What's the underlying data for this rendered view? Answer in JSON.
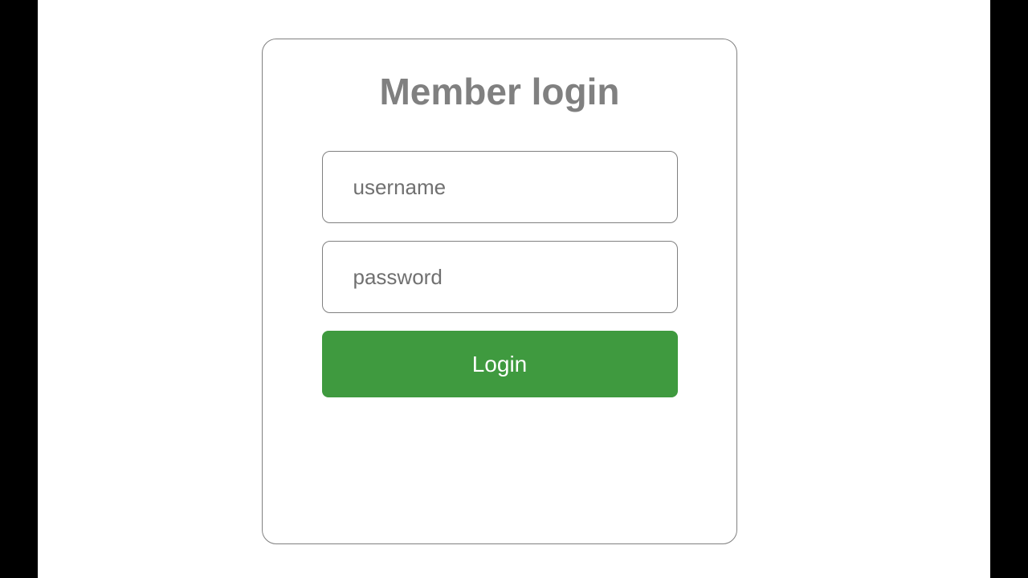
{
  "login": {
    "title": "Member login",
    "username_placeholder": "username",
    "password_placeholder": "password",
    "submit_label": "Login"
  }
}
